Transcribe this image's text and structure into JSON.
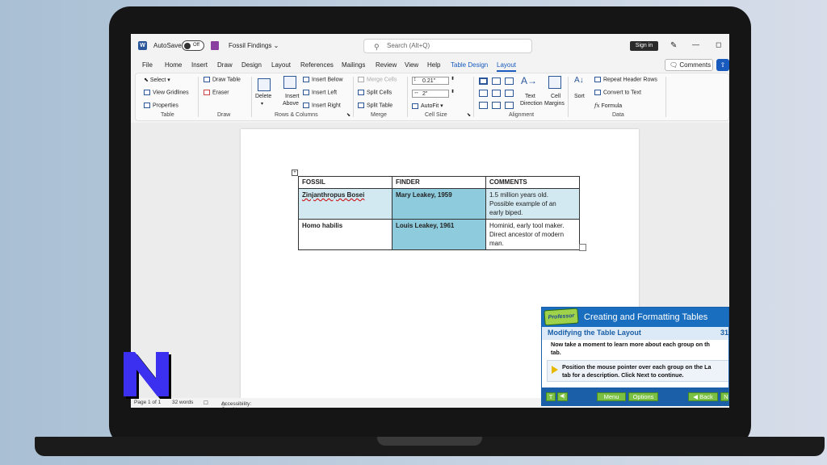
{
  "titlebar": {
    "autosave_label": "AutoSave",
    "autosave_state": "Off",
    "doc_title": "Fossil Findings",
    "search_placeholder": "Search (Alt+Q)",
    "sign_in": "Sign in"
  },
  "menu": {
    "items": [
      "File",
      "Home",
      "Insert",
      "Draw",
      "Design",
      "Layout",
      "References",
      "Mailings",
      "Review",
      "View",
      "Help",
      "Table Design",
      "Layout"
    ],
    "comments_label": "Comments"
  },
  "ribbon": {
    "table": {
      "select": "Select",
      "view_gridlines": "View Gridlines",
      "properties": "Properties",
      "label": "Table"
    },
    "draw": {
      "draw_table": "Draw Table",
      "eraser": "Eraser",
      "label": "Draw"
    },
    "rows_columns": {
      "delete": "Delete",
      "insert_above_1": "Insert",
      "insert_above_2": "Above",
      "insert_below": "Insert Below",
      "insert_left": "Insert Left",
      "insert_right": "Insert Right",
      "label": "Rows & Columns"
    },
    "merge": {
      "merge_cells": "Merge Cells",
      "split_cells": "Split Cells",
      "split_table": "Split Table",
      "label": "Merge"
    },
    "cell_size": {
      "height": "0.21\"",
      "width": "2\"",
      "autofit": "AutoFit",
      "label": "Cell Size"
    },
    "alignment": {
      "text_direction_1": "Text",
      "text_direction_2": "Direction",
      "cell_margins_1": "Cell",
      "cell_margins_2": "Margins",
      "label": "Alignment"
    },
    "data": {
      "sort": "Sort",
      "repeat_header": "Repeat Header Rows",
      "convert": "Convert to Text",
      "formula": "Formula",
      "label": "Data"
    }
  },
  "document": {
    "table": {
      "headers": [
        "FOSSIL",
        "FINDER",
        "COMMENTS"
      ],
      "rows": [
        {
          "fossil": "Zinjanthropus Bosei",
          "finder": "Mary Leakey, 1959",
          "comments": [
            "1.5 million years old.",
            "Possible example of an",
            "early biped."
          ]
        },
        {
          "fossil": "Homo habilis",
          "finder": "Louis Leakey, 1961",
          "comments": [
            "Hominid, early tool maker.",
            "Direct ancestor of modern",
            "man."
          ]
        }
      ]
    }
  },
  "statusbar": {
    "page": "Page 1 of 1",
    "words": "32 words",
    "accessibility": "Accessibility: Good to go"
  },
  "professor": {
    "logo_text": "Professor",
    "title": "Creating and Formatting Tables",
    "subtitle": "Modifying the Table Layout",
    "number": "31",
    "body1_line1": "Now take a moment to learn more about each group on th",
    "body1_line2": "tab.",
    "body2_line1": "Position the mouse pointer over each group on the La",
    "body2_line2": "tab for a description. Click Next to continue.",
    "btn_t": "T",
    "btn_sound": "◀)",
    "btn_menu": "Menu",
    "btn_options": "Options",
    "btn_back": "◀ Back",
    "btn_next": "N"
  },
  "colors": {
    "accent": "#185abd",
    "table_cell_light": "#d2e9f2",
    "table_cell_dark": "#8ecbdc",
    "professor_blue": "#1a6ec0",
    "professor_green": "#7ac043",
    "logo_blue": "#3b2ff0"
  }
}
